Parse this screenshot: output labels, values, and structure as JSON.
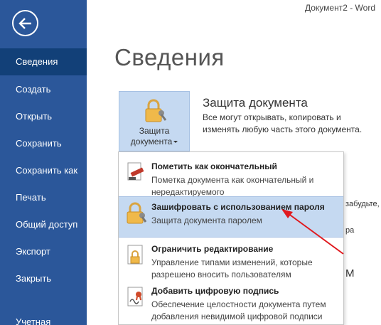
{
  "window": {
    "title": "Документ2  -  Word"
  },
  "sidebar": {
    "items": [
      {
        "label": "Сведения"
      },
      {
        "label": "Создать"
      },
      {
        "label": "Открыть"
      },
      {
        "label": "Сохранить"
      },
      {
        "label": "Сохранить как"
      },
      {
        "label": "Печать"
      },
      {
        "label": "Общий доступ"
      },
      {
        "label": "Экспорт"
      },
      {
        "label": "Закрыть"
      },
      {
        "label": "Учетная"
      }
    ],
    "active_index": 0
  },
  "main": {
    "title": "Сведения",
    "protect": {
      "button_label_1": "Защита",
      "button_label_2": "документа",
      "section_title": "Защита документа",
      "section_desc": "Все могут открывать, копировать и изменять любую часть этого документа."
    },
    "background_fragments": [
      "забудьте,",
      "ра",
      "M"
    ]
  },
  "menu": {
    "items": [
      {
        "title": "Пометить как окончательный",
        "desc": "Пометка документа как окончательный и нередактируемого",
        "icon": "mark-final-icon"
      },
      {
        "title": "Зашифровать с использованием пароля",
        "desc": "Защита документа паролем",
        "icon": "lock-icon",
        "highlighted": true
      },
      {
        "title": "Ограничить редактирование",
        "desc": "Управление типами изменений, которые разрешено вносить пользователям",
        "icon": "restrict-editing-icon"
      },
      {
        "title": "Добавить цифровую подпись",
        "desc": "Обеспечение целостности документа путем добавления невидимой цифровой подписи",
        "icon": "digital-signature-icon"
      }
    ]
  },
  "colors": {
    "sidebar": "#2b579a",
    "sidebar_active": "#124078",
    "highlight": "#c5d9f1",
    "annotation_arrow": "#e0191e"
  }
}
